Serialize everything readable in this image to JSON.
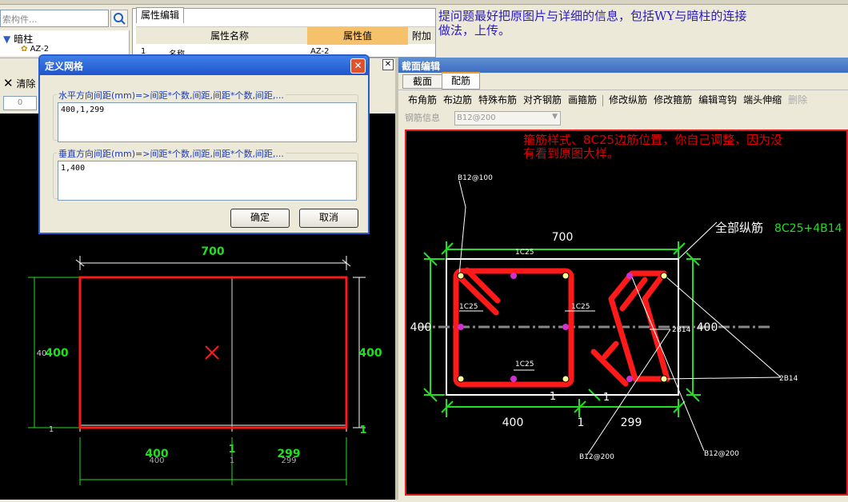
{
  "left_panel": {
    "search_placeholder": "索构件...",
    "tree_item": "暗柱",
    "tree_child": "AZ-2",
    "clear_label": "清除",
    "spin_value": "0"
  },
  "prop_editor": {
    "tab": "属性编辑",
    "col_name": "属性名称",
    "col_value": "属性值",
    "col_extra": "附加",
    "row_index": "1",
    "row_name": "名称",
    "row_value": "AZ-2"
  },
  "note_top": [
    "提问题最好把原图片与详细的信息，包括WY与暗柱的连接",
    "做法，上传。"
  ],
  "dialog": {
    "title": "定义网格",
    "h_label": "水平方向间距(mm)=>间距*个数,间距,间距*个数,间距,...",
    "h_value": "400,1,299",
    "v_label": "垂直方向间距(mm)=>间距*个数,间距,间距*个数,间距,...",
    "v_value": "1,400",
    "ok": "确定",
    "cancel": "取消"
  },
  "left_drawing": {
    "top_dim": "700",
    "left_dim": "400",
    "left_dim_small": "40",
    "left_dim_bottom": "1",
    "right_dim": "400",
    "right_dim_bottom": "1",
    "bottom_dims": [
      "400",
      "1",
      "299"
    ],
    "bottom_dims_small": [
      "400",
      "1",
      "299"
    ]
  },
  "section_editor": {
    "title": "截面编辑",
    "tabs": [
      "截面",
      "配筋"
    ],
    "active_tab": "配筋",
    "toolbar": [
      "布角筋",
      "布边筋",
      "特殊布筋",
      "对齐钢筋",
      "画箍筋",
      "修改纵筋",
      "修改箍筋",
      "编辑弯钩",
      "端头伸缩",
      "删除"
    ],
    "rebar_info_label": "钢筋信息",
    "rebar_info_value": "B12@200"
  },
  "section_drawing": {
    "note": [
      "箍筋样式、8C25边筋位置，你自己调整，因为没",
      "有看到原图大样。"
    ],
    "total_label": "全部纵筋",
    "total_value": "8C25+4B14",
    "top_dim": "700",
    "left_dim": "400",
    "right_dim": "400",
    "bottom_dims": [
      "400",
      "1",
      "299"
    ],
    "inner_marks": [
      "1",
      "1"
    ],
    "labels": {
      "stirrup_top": "B12@100",
      "bar_top": "1C25",
      "bar_left": "1C25",
      "bar_mid": "1C25",
      "bar_bottom": "1C25",
      "bar_b14": "2B14",
      "bar_b14_right": "2B14",
      "stirrup_bottom_left": "B12@200",
      "stirrup_bottom_right": "B12@200"
    }
  },
  "colors": {
    "canvas_bg": "#000000",
    "dim_green": "#22dd22",
    "rebar_red": "#ff1a1a",
    "annotation_red": "#e00000",
    "text_purple": "#2a1bbf",
    "title_blue": "#3d6dc0"
  }
}
